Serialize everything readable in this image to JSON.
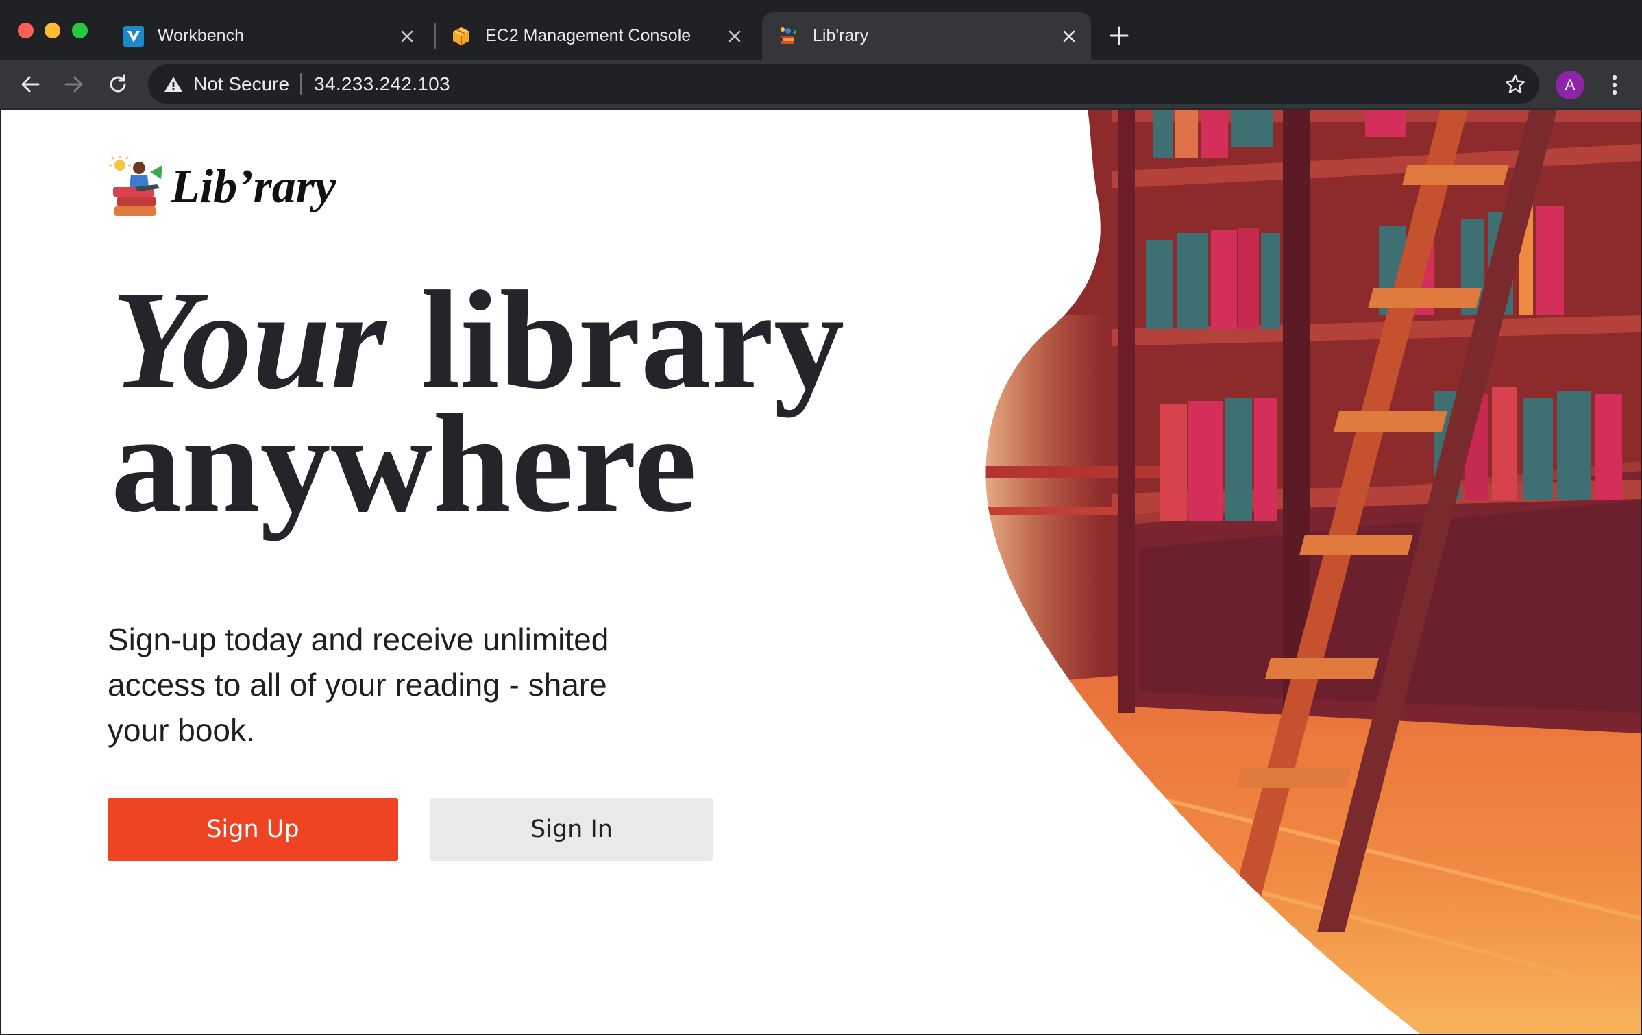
{
  "browser": {
    "tabs": [
      {
        "title": "Workbench",
        "favicon": "vocareum-v-icon",
        "active": false
      },
      {
        "title": "EC2 Management Console",
        "favicon": "aws-cube-icon",
        "active": false
      },
      {
        "title": "Lib'rary",
        "favicon": "library-logo-icon",
        "active": true
      }
    ],
    "address": {
      "security_label": "Not Secure",
      "url": "34.233.242.103"
    },
    "profile_initial": "A"
  },
  "page": {
    "brand": {
      "name": "Lib’rary"
    },
    "hero": {
      "headline_italic": "Your",
      "headline_rest": " library",
      "headline_line2": "anywhere",
      "tagline": "Sign-up today and receive unlimited access to all of your reading - share your book."
    },
    "actions": {
      "sign_up": "Sign Up",
      "sign_in": "Sign In"
    }
  },
  "colors": {
    "accent": "#ef4423",
    "secondary_button": "#e9e9e9",
    "headline": "#23252a"
  }
}
